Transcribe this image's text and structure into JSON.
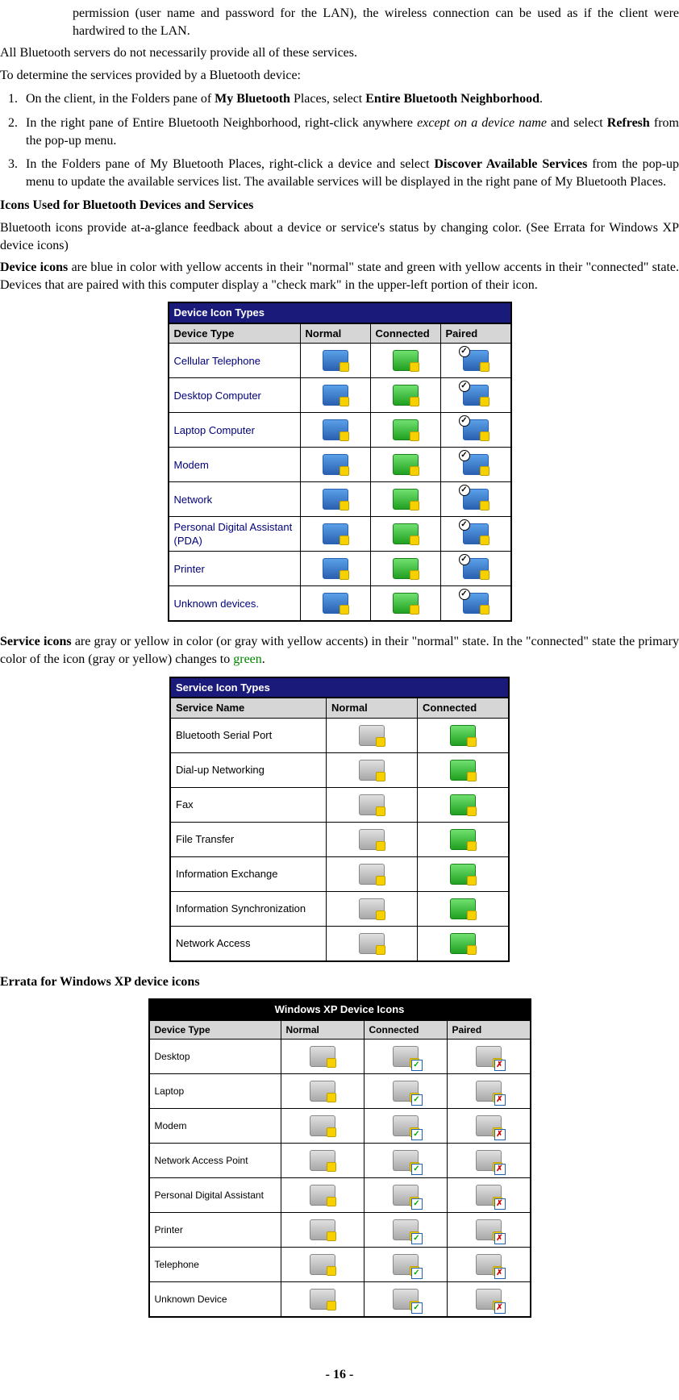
{
  "intro": {
    "cont_para": "permission (user name and password for the LAN), the wireless connection can be used as if the client were hardwired to the LAN.",
    "p1": "All Bluetooth servers do not necessarily provide all of these services.",
    "p2": "To determine the services provided by a Bluetooth device:"
  },
  "steps": {
    "s1_a": "On the client, in the Folders pane of ",
    "s1_b": "My Bluetooth",
    "s1_c": " Places, select ",
    "s1_d": "Entire Bluetooth Neighborhood",
    "s1_e": ".",
    "s2_a": " In the right pane of Entire Bluetooth Neighborhood, right-click anywhere ",
    "s2_b": "except on a device name",
    "s2_c": " and select ",
    "s2_d": "Refresh",
    "s2_e": " from the pop-up menu.",
    "s3_a": "In the Folders pane of My Bluetooth Places, right-click a device and select ",
    "s3_b": "Discover Available Services",
    "s3_c": " from the pop-up menu to update the available services list. The available services will be displayed in the right pane of My Bluetooth Places."
  },
  "sections": {
    "icons_heading": "Icons Used for Bluetooth Devices and Services",
    "icons_para": "Bluetooth icons provide at-a-glance feedback about a device or service's status by changing color. (See Errata for Windows XP device icons)",
    "device_a": "Device icons",
    "device_b": " are blue in color with yellow accents in their \"normal\" state and green with yellow accents in their \"connected\" state. Devices that are paired with this computer display a \"check mark\" in the upper-left portion of their icon.",
    "service_a": "Service icons",
    "service_b": " are gray or yellow in color (or gray with yellow accents) in their \"normal\" state. In the \"connected\" state the primary color of the icon (gray or yellow) changes to ",
    "service_c": "green",
    "service_d": ".",
    "errata_heading": "Errata for Windows XP device icons"
  },
  "table1": {
    "caption": "Device Icon Types",
    "headers": [
      "Device Type",
      "Normal",
      "Connected",
      "Paired"
    ],
    "rows": [
      "Cellular Telephone",
      "Desktop Computer",
      "Laptop Computer",
      "Modem",
      "Network",
      "Personal Digital Assistant (PDA)",
      "Printer",
      "Unknown devices."
    ]
  },
  "table2": {
    "caption": "Service Icon Types",
    "headers": [
      "Service Name",
      "Normal",
      "Connected"
    ],
    "rows": [
      "Bluetooth Serial Port",
      "Dial-up Networking",
      "Fax",
      "File Transfer",
      "Information Exchange",
      "Information Synchronization",
      "Network Access"
    ]
  },
  "table3": {
    "caption": "Windows XP Device Icons",
    "headers": [
      "Device Type",
      "Normal",
      "Connected",
      "Paired"
    ],
    "rows": [
      "Desktop",
      "Laptop",
      "Modem",
      "Network Access Point",
      "Personal Digital Assistant",
      "Printer",
      "Telephone",
      "Unknown Device"
    ]
  },
  "footer": "- 16 -"
}
